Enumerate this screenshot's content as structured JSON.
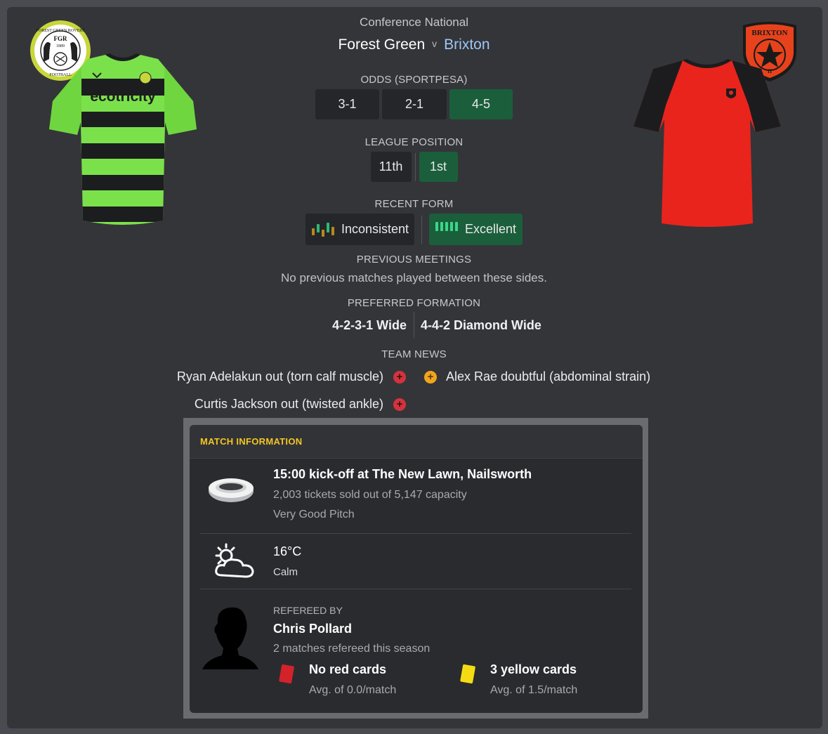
{
  "header": {
    "competition": "Conference National",
    "home_team": "Forest Green",
    "vs": "v",
    "away_team": "Brixton"
  },
  "crests": {
    "home_text_top": "FOREST GREEN ROVERS",
    "home_text_mid": "FGR",
    "home_text_year": "1889",
    "home_text_bottom": "FOOTBALL",
    "away_text": "BRIXTON",
    "away_text_small": "II"
  },
  "jersey": {
    "home_sponsor": "ecotricity"
  },
  "odds": {
    "label": "ODDS (SPORTPESA)",
    "home": "3-1",
    "draw": "2-1",
    "away": "4-5"
  },
  "league_position": {
    "label": "LEAGUE POSITION",
    "home": "11th",
    "away": "1st"
  },
  "recent_form": {
    "label": "RECENT FORM",
    "home": "Inconsistent",
    "away": "Excellent"
  },
  "previous_meetings": {
    "label": "PREVIOUS MEETINGS",
    "text": "No previous matches played between these sides."
  },
  "preferred_formation": {
    "label": "PREFERRED FORMATION",
    "home": "4-2-3-1 Wide",
    "away": "4-4-2 Diamond Wide"
  },
  "team_news": {
    "label": "TEAM NEWS",
    "home": [
      "Ryan Adelakun out (torn calf muscle)",
      "Curtis Jackson out (twisted ankle)"
    ],
    "away": [
      "Alex Rae doubtful (abdominal strain)"
    ]
  },
  "match_info": {
    "header": "MATCH INFORMATION",
    "venue": {
      "title": "15:00 kick-off at The New Lawn, Nailsworth",
      "tickets": "2,003 tickets sold out of 5,147 capacity",
      "pitch": "Very Good Pitch"
    },
    "weather": {
      "temperature": "16°C",
      "wind": "Calm"
    },
    "referee": {
      "label": "REFEREED BY",
      "name": "Chris Pollard",
      "matches": "2 matches refereed this season",
      "red_title": "No red cards",
      "red_avg": "Avg. of 0.0/match",
      "yellow_title": "3 yellow cards",
      "yellow_avg": "Avg. of 1.5/match"
    }
  },
  "colors": {
    "accent_header": "#f3c623",
    "away_link": "#9ec6f4",
    "best_chip": "#1b5e3b",
    "red_dot": "#d2333c",
    "amber_dot": "#f0a51e"
  }
}
